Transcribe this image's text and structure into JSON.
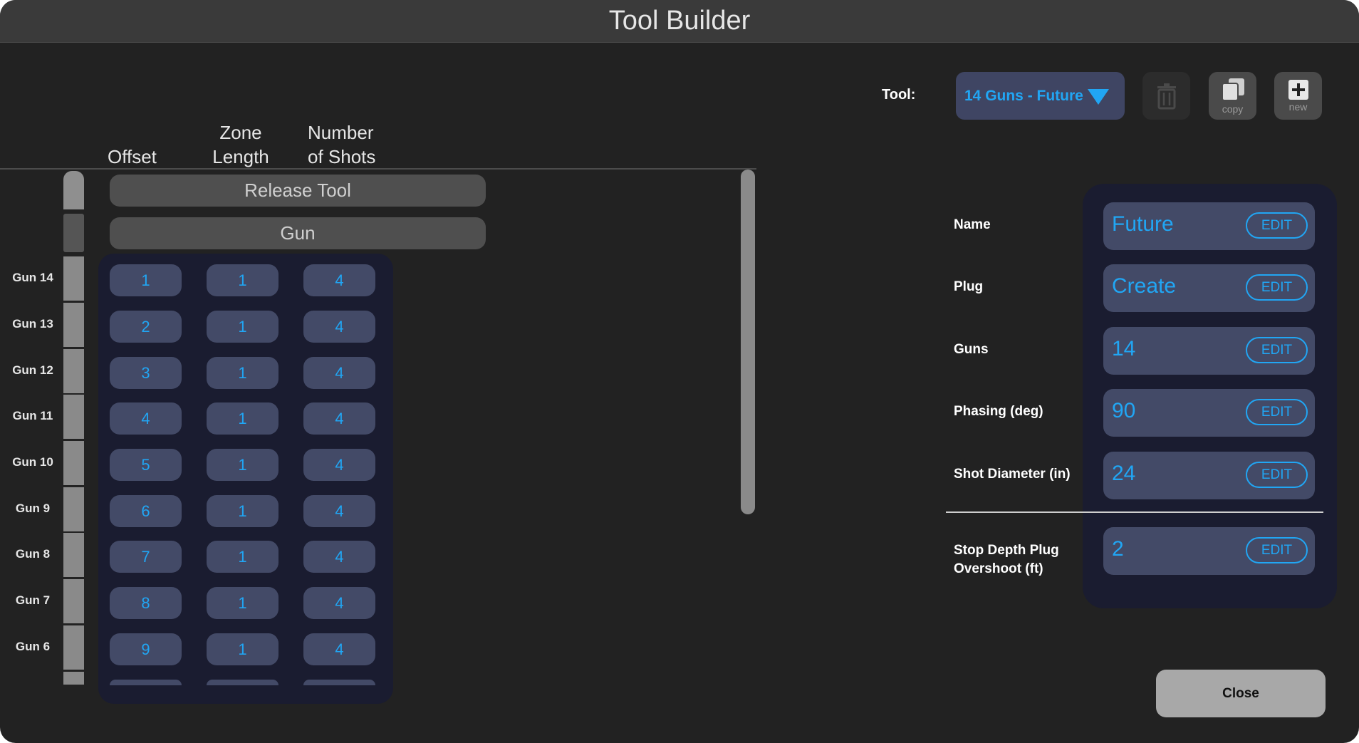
{
  "window": {
    "title": "Tool Builder"
  },
  "toolbar": {
    "tool_label": "Tool:",
    "tool_value": "14 Guns - Future",
    "copy_caption": "copy",
    "new_caption": "new",
    "accent": "#21a6f4"
  },
  "grid": {
    "headers": {
      "offset": "Offset",
      "zone_line1": "Zone",
      "zone_line2": "Length",
      "shots_line1": "Number",
      "shots_line2": "of Shots"
    },
    "release_tool": "Release Tool",
    "gun": "Gun",
    "rows": [
      {
        "label": "Gun 14",
        "offset": "1",
        "zone": "1",
        "shots": "4"
      },
      {
        "label": "Gun 13",
        "offset": "2",
        "zone": "1",
        "shots": "4"
      },
      {
        "label": "Gun 12",
        "offset": "3",
        "zone": "1",
        "shots": "4"
      },
      {
        "label": "Gun 11",
        "offset": "4",
        "zone": "1",
        "shots": "4"
      },
      {
        "label": "Gun 10",
        "offset": "5",
        "zone": "1",
        "shots": "4"
      },
      {
        "label": "Gun 9",
        "offset": "6",
        "zone": "1",
        "shots": "4"
      },
      {
        "label": "Gun 8",
        "offset": "7",
        "zone": "1",
        "shots": "4"
      },
      {
        "label": "Gun 7",
        "offset": "8",
        "zone": "1",
        "shots": "4"
      },
      {
        "label": "Gun 6",
        "offset": "9",
        "zone": "1",
        "shots": "4"
      }
    ]
  },
  "properties": {
    "edit_label": "EDIT",
    "name": {
      "label": "Name",
      "value": "Future"
    },
    "plug": {
      "label": "Plug",
      "value": "Create"
    },
    "guns": {
      "label": "Guns",
      "value": "14"
    },
    "phasing": {
      "label": "Phasing (deg)",
      "value": "90"
    },
    "shot_diameter": {
      "label": "Shot Diameter (in)",
      "value": "24"
    },
    "stop_depth": {
      "label_line1": "Stop Depth Plug",
      "label_line2": "Overshoot (ft)",
      "value": "2"
    }
  },
  "footer": {
    "close_label": "Close"
  }
}
